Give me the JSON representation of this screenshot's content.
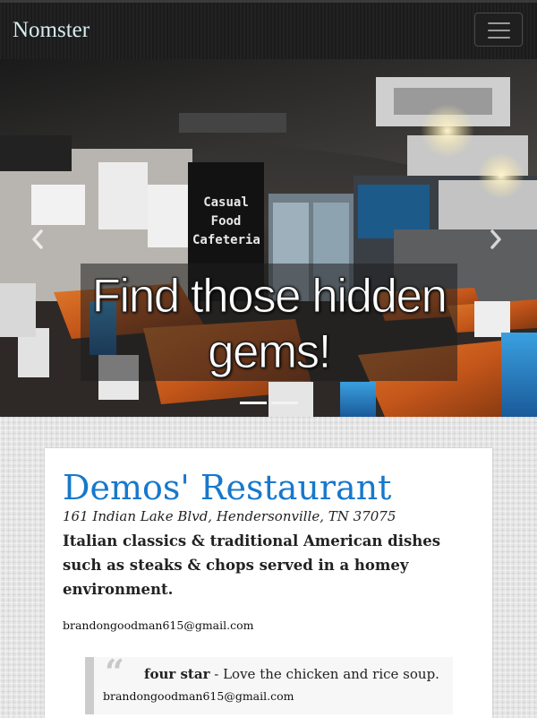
{
  "navbar": {
    "brand": "Nomster"
  },
  "carousel": {
    "caption": "Find those hidden gems!",
    "sign_lines": [
      "Casual",
      "Food",
      "Cafeteria"
    ],
    "slide_count": 2,
    "active_slide": 1
  },
  "place": {
    "name": "Demos' Restaurant",
    "address": "161 Indian Lake Blvd, Hendersonville, TN 37075",
    "description": "Italian classics & traditional American dishes such as steaks & chops served in a homey environment.",
    "owner_email": "brandongoodman615@gmail.com",
    "review": {
      "rating": "four star",
      "separator": " - ",
      "message": "Love the chicken and rice soup.",
      "author": "brandongoodman615@gmail.com"
    }
  },
  "colors": {
    "link": "#1778cc",
    "navbar": "#1b1b1b",
    "brand": "#d7ecef"
  },
  "icons": {
    "prev": "chevron-left-icon",
    "next": "chevron-right-icon",
    "menu": "hamburger-icon",
    "quote": "quote-icon"
  }
}
